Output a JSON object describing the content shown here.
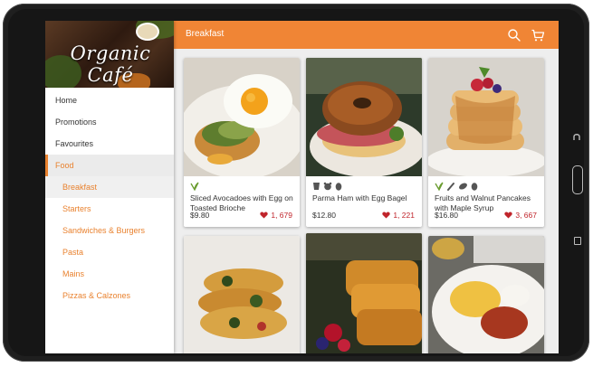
{
  "app": {
    "logo_text": "Organic Café"
  },
  "topbar": {
    "title": "Breakfast",
    "icons": [
      "search-icon",
      "cart-icon"
    ]
  },
  "sidebar": {
    "items": [
      {
        "label": "Home",
        "level": "top"
      },
      {
        "label": "Promotions",
        "level": "top"
      },
      {
        "label": "Favourites",
        "level": "top"
      },
      {
        "label": "Food",
        "level": "top",
        "active": true
      },
      {
        "label": "Breakfast",
        "level": "sub",
        "selected": true
      },
      {
        "label": "Starters",
        "level": "sub"
      },
      {
        "label": "Sandwiches & Burgers",
        "level": "sub"
      },
      {
        "label": "Pasta",
        "level": "sub"
      },
      {
        "label": "Mains",
        "level": "sub"
      },
      {
        "label": "Pizzas & Calzones",
        "level": "sub"
      }
    ]
  },
  "products": [
    {
      "name": "Sliced Avocadoes with Egg on Toasted Brioche",
      "price": "$9.80",
      "likes": "1, 679",
      "tags": [
        "vegetarian-icon"
      ]
    },
    {
      "name": "Parma Ham with Egg Bagel",
      "price": "$12.80",
      "likes": "1, 221",
      "tags": [
        "cup-icon",
        "pig-icon",
        "egg-icon"
      ]
    },
    {
      "name": "Fruits and Walnut Pancakes with Maple Syrup",
      "price": "$16.80",
      "likes": "3, 667",
      "tags": [
        "vegetarian-icon",
        "chili-icon",
        "nut-icon",
        "egg-icon"
      ]
    }
  ],
  "colors": {
    "accent": "#f08535",
    "like": "#c0242b",
    "sub_item": "#e9822f"
  }
}
